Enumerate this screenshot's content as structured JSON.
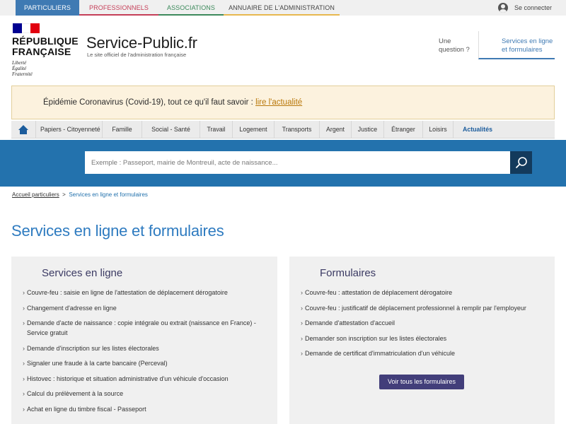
{
  "audience_tabs": [
    {
      "label": "PARTICULIERS"
    },
    {
      "label": "PROFESSIONNELS"
    },
    {
      "label": "ASSOCIATIONS"
    },
    {
      "label": "ANNUAIRE DE L'ADMINISTRATION"
    }
  ],
  "account": {
    "connect_label": "Se connecter"
  },
  "header": {
    "rf_line1": "RÉPUBLIQUE",
    "rf_line2": "FRANÇAISE",
    "motto_1": "Liberté",
    "motto_2": "Égalité",
    "motto_3": "Fraternité",
    "site_name": "Service-Public.fr",
    "tagline": "Le site officiel de l'administration française",
    "nav_question_1": "Une",
    "nav_question_2": "question ?",
    "nav_services_1": "Services en ligne",
    "nav_services_2": "et formulaires"
  },
  "alert": {
    "text": "Épidémie Coronavirus (Covid-19), tout ce qu'il faut savoir : ",
    "link": "lire l'actualité"
  },
  "themes": [
    {
      "label": "Papiers - Citoyenneté"
    },
    {
      "label": "Famille"
    },
    {
      "label": "Social - Santé"
    },
    {
      "label": "Travail"
    },
    {
      "label": "Logement"
    },
    {
      "label": "Transports"
    },
    {
      "label": "Argent"
    },
    {
      "label": "Justice"
    },
    {
      "label": "Étranger"
    },
    {
      "label": "Loisirs"
    },
    {
      "label": "Actualités"
    }
  ],
  "search": {
    "placeholder": "Exemple : Passeport, mairie de Montreuil, acte de naissance..."
  },
  "breadcrumb": {
    "home": "Accueil particuliers",
    "separator": ">",
    "current": "Services en ligne et formulaires"
  },
  "page_title": "Services en ligne et formulaires",
  "services": {
    "title": "Services en ligne",
    "items": [
      "Couvre-feu : saisie en ligne de l'attestation de déplacement dérogatoire",
      "Changement d'adresse en ligne",
      "Demande d'acte de naissance : copie intégrale ou extrait (naissance en France) - Service gratuit",
      "Demande d'inscription sur les listes électorales",
      "Signaler une fraude à la carte bancaire (Perceval)",
      "Histovec : historique et situation administrative d'un véhicule d'occasion",
      "Calcul du prélèvement à la source",
      "Achat en ligne du timbre fiscal - Passeport"
    ]
  },
  "formulaires": {
    "title": "Formulaires",
    "items": [
      "Couvre-feu : attestation de déplacement dérogatoire",
      "Couvre-feu : justificatif de déplacement professionnel à remplir par l'employeur",
      "Demande d'attestation d'accueil",
      "Demander son inscription sur les listes électorales",
      "Demande de certificat d'immatriculation d'un véhicule"
    ],
    "button": "Voir tous les formulaires"
  },
  "colors": {
    "brand_blue": "#2372ad",
    "title_blue": "#2e7bc0",
    "dark_purple": "#423e7a",
    "alert_bg": "#fcf2de",
    "flag_blue": "#000091",
    "flag_red": "#e1000f"
  }
}
